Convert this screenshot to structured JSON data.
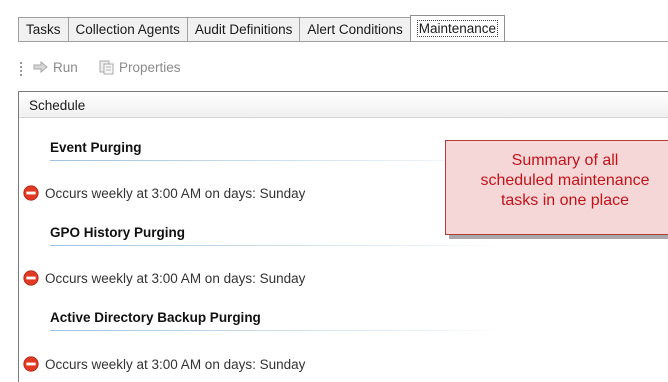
{
  "tabs": [
    {
      "label": "Tasks",
      "active": false
    },
    {
      "label": "Collection Agents",
      "active": false
    },
    {
      "label": "Audit Definitions",
      "active": false
    },
    {
      "label": "Alert Conditions",
      "active": false
    },
    {
      "label": "Maintenance",
      "active": true
    }
  ],
  "toolbar": {
    "run_label": "Run",
    "properties_label": "Properties"
  },
  "list": {
    "column_header": "Schedule",
    "groups": [
      {
        "title": "Event Purging",
        "schedule": "Occurs weekly at 3:00 AM on days: Sunday"
      },
      {
        "title": "GPO History Purging",
        "schedule": "Occurs weekly at 3:00 AM on days: Sunday"
      },
      {
        "title": "Active Directory Backup Purging",
        "schedule": "Occurs weekly at 3:00 AM on days: Sunday"
      }
    ]
  },
  "callout": {
    "lines": [
      "Summary of all",
      "scheduled maintenance",
      "tasks in one place"
    ]
  },
  "colors": {
    "callout_text": "#c0141b",
    "callout_bg": "#f5d7d7",
    "stop_icon": "#e03a24"
  }
}
